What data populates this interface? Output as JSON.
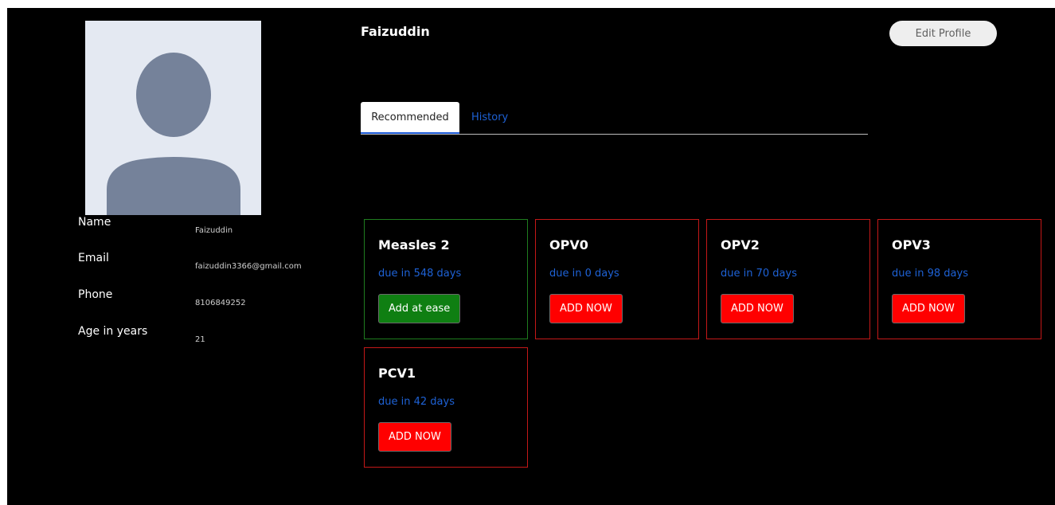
{
  "profile": {
    "name": "Faizuddin",
    "edit_label": "Edit Profile",
    "fields": [
      {
        "label": "Name",
        "value": "Faizuddin"
      },
      {
        "label": "Email",
        "value": "faizuddin3366@gmail.com"
      },
      {
        "label": "Phone",
        "value": "8106849252"
      },
      {
        "label": "Age in years",
        "value": "21"
      }
    ]
  },
  "tabs": [
    {
      "label": "Recommended",
      "active": true
    },
    {
      "label": "History",
      "active": false
    }
  ],
  "vaccines": [
    {
      "name": "Measles 2",
      "due": "due in 548 days",
      "action": "Add at ease",
      "status": "green"
    },
    {
      "name": "OPV0",
      "due": "due in 0 days",
      "action": "ADD NOW",
      "status": "red"
    },
    {
      "name": "OPV2",
      "due": "due in 70 days",
      "action": "ADD NOW",
      "status": "red"
    },
    {
      "name": "OPV3",
      "due": "due in 98 days",
      "action": "ADD NOW",
      "status": "red"
    },
    {
      "name": "PCV1",
      "due": "due in 42 days",
      "action": "ADD NOW",
      "status": "red"
    }
  ],
  "colors": {
    "background": "#000000",
    "urgent": "#ff0000",
    "ok": "#0f7f12",
    "link": "#1e62d6"
  },
  "icons": {
    "avatar": "user-silhouette-icon"
  }
}
